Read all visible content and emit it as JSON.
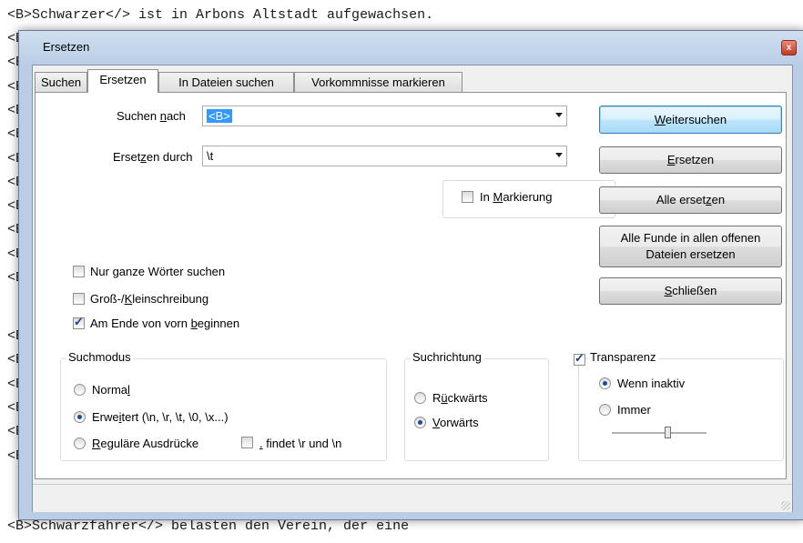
{
  "editor": {
    "lines": [
      {
        "text": "<B>Schwarzer</> ist in Arbons Altstadt aufgewachsen."
      },
      {
        "text": "<B"
      },
      {
        "text": "<B"
      },
      {
        "text": "<B"
      },
      {
        "text": "<B"
      },
      {
        "text": "<B"
      },
      {
        "text": "<B"
      },
      {
        "text": "<B"
      },
      {
        "text": "<B"
      },
      {
        "text": "<B"
      },
      {
        "text": "<B"
      },
      {
        "text": "<B"
      },
      {
        "text": "<B"
      },
      {
        "text": "<B"
      },
      {
        "text": "<B"
      },
      {
        "text": "<B"
      },
      {
        "text": "<B"
      },
      {
        "text": "<B"
      },
      {
        "text": "<B>Schwarzfahrer</> belasten den Verein, der eine"
      }
    ]
  },
  "dialog": {
    "title": "Ersetzen",
    "close_glyph": "x",
    "tabs": [
      {
        "label": "Suchen"
      },
      {
        "label": "Ersetzen"
      },
      {
        "label": "In Dateien suchen"
      },
      {
        "label": "Vorkommnisse markieren"
      }
    ],
    "find": {
      "label_pre": "Suchen ",
      "label_u": "n",
      "label_post": "ach",
      "value": "<B>"
    },
    "replace": {
      "label_pre": "Erset",
      "label_u": "z",
      "label_post": "en durch",
      "value": "\\t"
    },
    "in_selection": {
      "label_pre": "In ",
      "label_u": "M",
      "label_post": "arkierung",
      "checked": false
    },
    "buttons": {
      "find_next": {
        "pre": "",
        "u": "W",
        "post": "eitersuchen"
      },
      "replace": {
        "pre": "",
        "u": "E",
        "post": "rsetzen"
      },
      "replace_all": {
        "pre": "Alle erset",
        "u": "z",
        "post": "en"
      },
      "replace_all_open_line1": "Alle Funde in allen offenen",
      "replace_all_open_line2": "Dateien ersetzen",
      "close": {
        "pre": "",
        "u": "S",
        "post": "chließen"
      }
    },
    "options": {
      "whole_word": {
        "pre": "Nur ",
        "u": "g",
        "post": "anze Wörter suchen",
        "checked": false
      },
      "match_case": {
        "pre": "Groß-/",
        "u": "K",
        "post": "leinschreibung",
        "checked": false
      },
      "wrap": {
        "pre": "Am Ende von vorn ",
        "u": "b",
        "post": "eginnen",
        "checked": true
      }
    },
    "search_mode": {
      "title": "Suchmodus",
      "normal": {
        "pre": "Norma",
        "u": "l",
        "post": "",
        "selected": false
      },
      "extended": {
        "pre": "Erwe",
        "u": "i",
        "post": "tert (\\n, \\r, \\t, \\0, \\x...)",
        "selected": true
      },
      "regex": {
        "pre": "",
        "u": "R",
        "post": "eguläre Ausdrücke",
        "selected": false
      },
      "dot_newline": {
        "u": ".",
        "post": " findet \\r und \\n",
        "checked": false
      }
    },
    "direction": {
      "title": "Suchrichtung",
      "up": {
        "pre": "R",
        "u": "ü",
        "post": "ckwärts",
        "selected": false
      },
      "down": {
        "pre": "",
        "u": "V",
        "post": "orwärts",
        "selected": true
      }
    },
    "transparency": {
      "title": "Transparenz",
      "checked": true,
      "on_lose_focus": {
        "label": "Wenn inaktiv",
        "selected": true
      },
      "always": {
        "label": "Immer",
        "selected": false
      },
      "slider_value": 0.6
    },
    "colors": {
      "accent": "#3399ff",
      "frame": "#b9cde4"
    }
  }
}
